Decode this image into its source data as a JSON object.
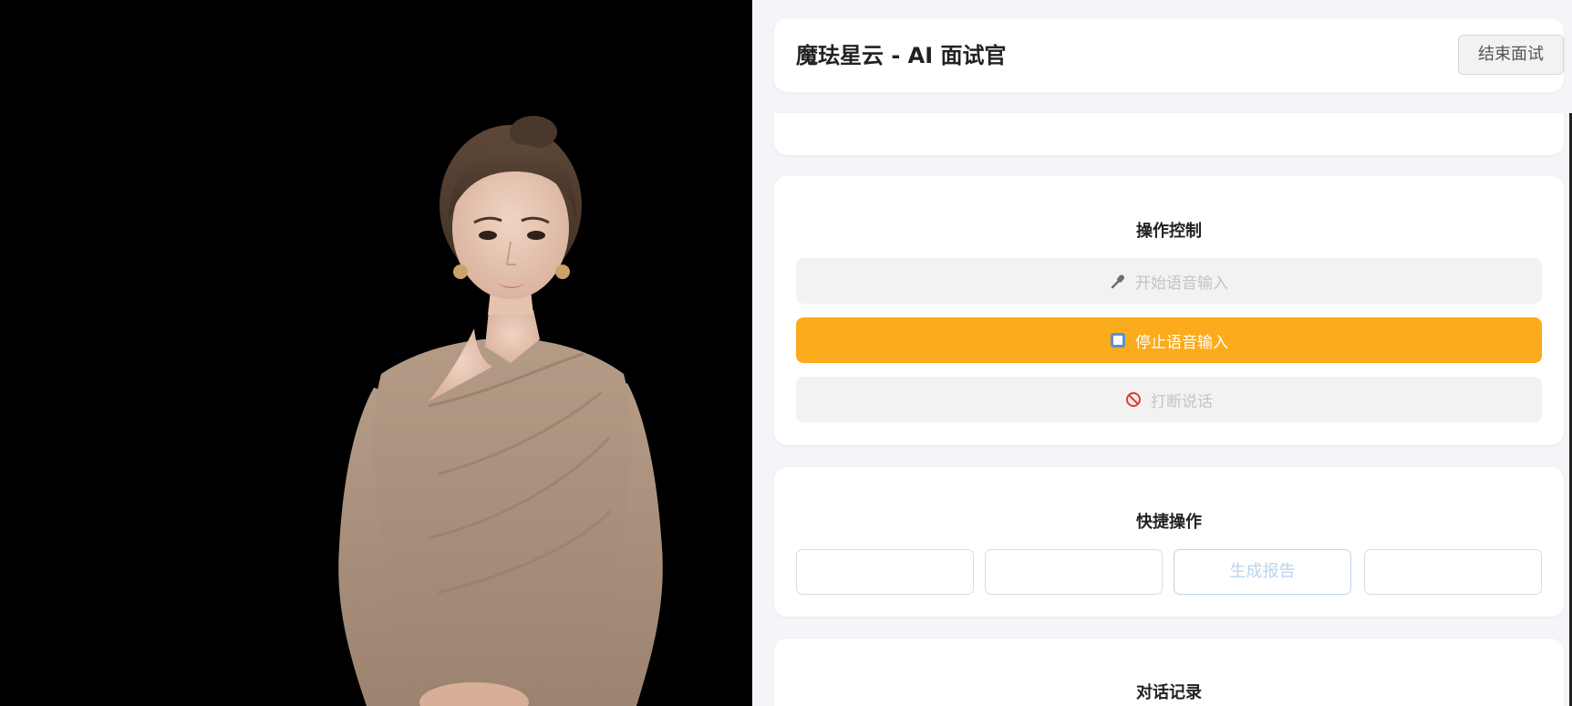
{
  "header": {
    "title": "魔珐星云 - AI 面试官",
    "end_button": "结束面试"
  },
  "controls": {
    "title": "操作控制",
    "start_voice": "开始语音输入",
    "stop_voice": "停止语音输入",
    "interrupt": "打断说话"
  },
  "quick_actions": {
    "title": "快捷操作",
    "buttons": [
      "",
      "",
      "生成报告",
      ""
    ]
  },
  "dialog_log": {
    "title": "对话记录"
  },
  "colors": {
    "accent": "#fbab1c",
    "disabled_bg": "#f2f2f2",
    "video_bg": "#000000"
  },
  "icons": {
    "start_voice": "microphone-icon",
    "stop_voice": "stop-square-icon",
    "interrupt": "no-entry-icon"
  }
}
